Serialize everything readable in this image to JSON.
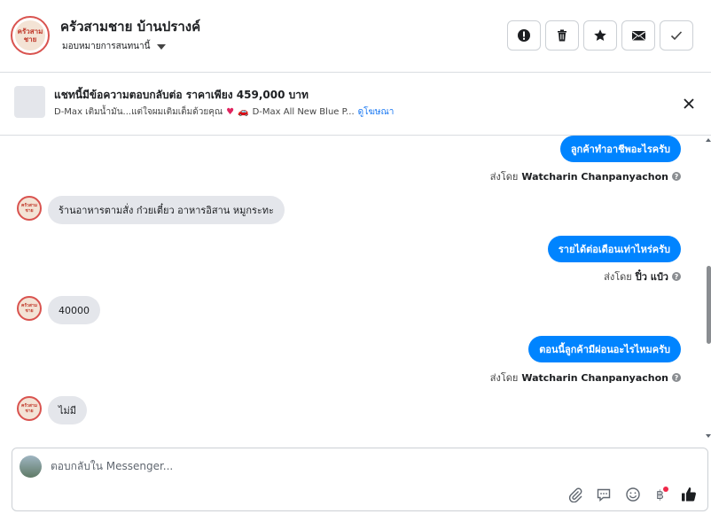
{
  "header": {
    "title": "ครัวสามชาย บ้านปรางค์",
    "subtitle": "มอบหมายการสนทนานี้",
    "page_logo_text": "ครัวสามชาย",
    "buttons": {
      "spam_icon": "exclamation-circle-icon",
      "delete_icon": "trash-icon",
      "star_icon": "star-icon",
      "unread_icon": "envelope-icon",
      "done_icon": "check-icon"
    }
  },
  "ad": {
    "title": "แชทนี้มีข้อความตอบกลับต่อ ราคาเพียง 459,000 บาท",
    "desc_part1": "D-Max เติมน้ำมัน...แต่ใจผมเติมเต็มด้วยคุณ",
    "desc_part2": "D-Max All New Blue P...",
    "link": "ดูโฆษณา"
  },
  "conversation": {
    "messages": [
      {
        "direction": "out",
        "text": "ลูกค้าทำอาชีพอะไรครับ",
        "sent_by_label": "ส่งโดย",
        "sender": "Watcharin Chanpanyachon"
      },
      {
        "direction": "in",
        "text": "ร้านอาหารตามสั่ง ก๋วยเตี๋ยว อาหารอิสาน หมูกระทะ"
      },
      {
        "direction": "out",
        "text": "รายได้ต่อเดือนเท่าไหร่ครับ",
        "sent_by_label": "ส่งโดย",
        "sender": "ปิ๋ว แป๋ว"
      },
      {
        "direction": "in",
        "text": "40000"
      },
      {
        "direction": "out",
        "text": "ตอนนี้ลูกค้ามีผ่อนอะไรไหมครับ",
        "sent_by_label": "ส่งโดย",
        "sender": "Watcharin Chanpanyachon"
      },
      {
        "direction": "in",
        "text": "ไม่มี"
      }
    ]
  },
  "composer": {
    "placeholder": "ตอบกลับใน Messenger...",
    "toolbar_icons": [
      "paperclip-icon",
      "saved-replies-icon",
      "emoji-icon",
      "baht-icon",
      "thumbs-up-icon"
    ]
  },
  "colors": {
    "accent": "#0084ff",
    "incoming_bubble": "#e4e6eb",
    "brand_red": "#d9534f"
  }
}
